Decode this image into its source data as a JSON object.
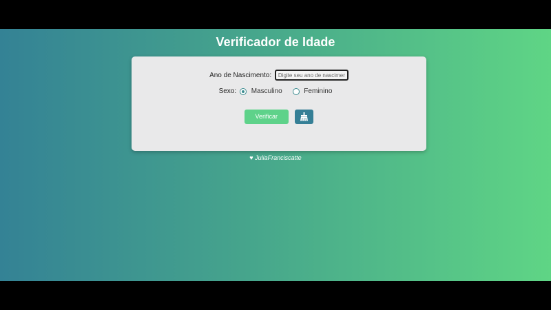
{
  "page": {
    "title": "Verificador de Idade"
  },
  "form": {
    "year_label": "Ano de Nascimento:",
    "year_placeholder": "Digite seu ano de nascimento",
    "year_value": "",
    "sex_label": "Sexo:",
    "options": [
      {
        "label": "Masculino",
        "selected": true
      },
      {
        "label": "Feminino",
        "selected": false
      }
    ],
    "verify_button": "Verificar",
    "clear_icon": "broom-icon"
  },
  "footer": {
    "heart": "♥",
    "author": "JuliaFranciscatte"
  },
  "colors": {
    "gradient_start": "#348295",
    "gradient_end": "#5fd585",
    "verify_button": "#5ed28a",
    "clear_button": "#357f96",
    "card": "#e9e9ea"
  }
}
